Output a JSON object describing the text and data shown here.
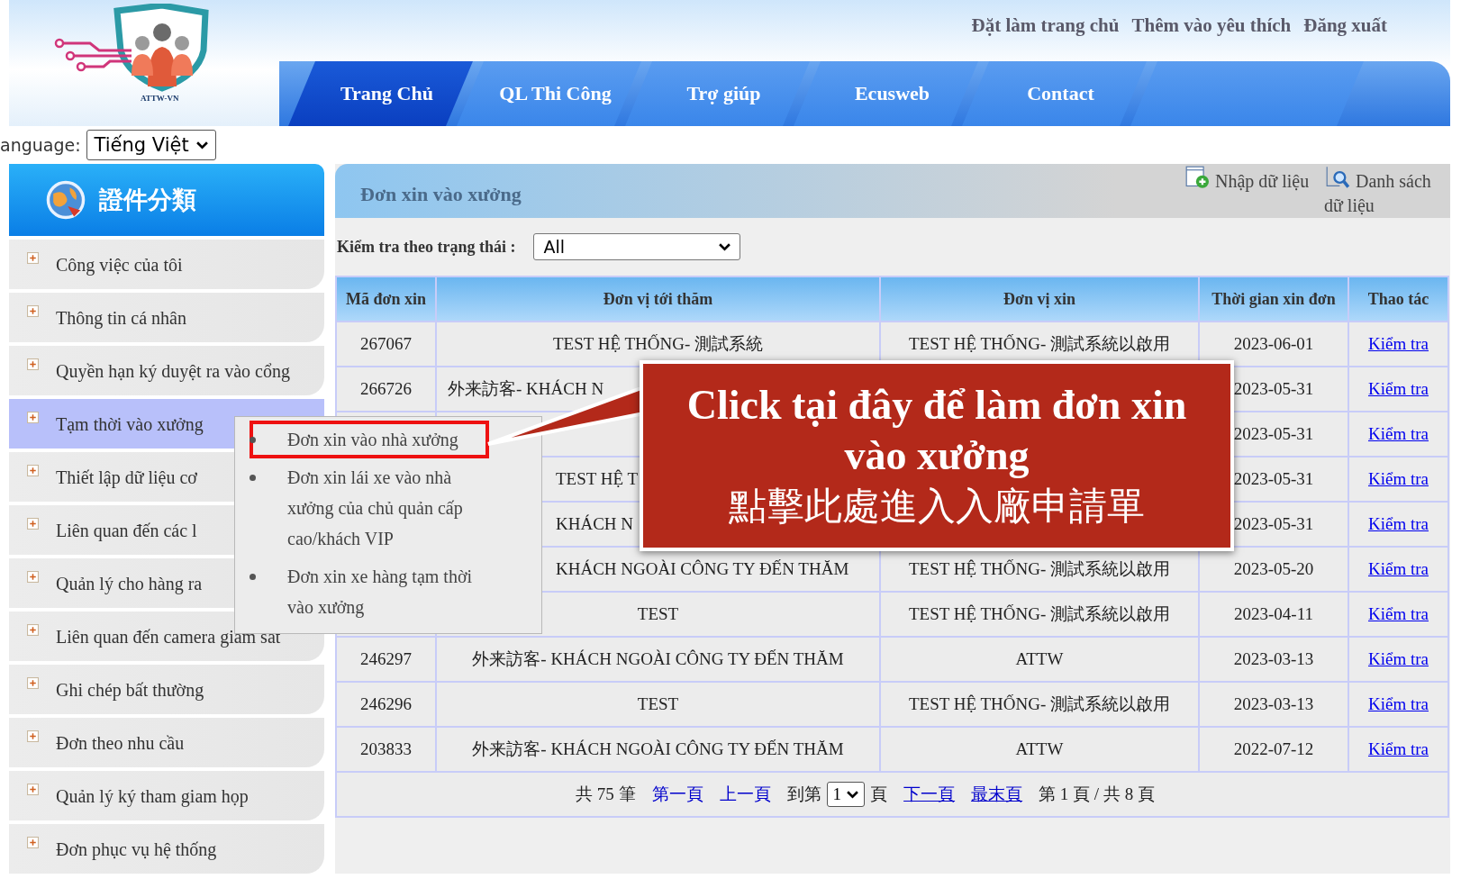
{
  "logo": {
    "caption": "ATTW-VN"
  },
  "top_links": [
    "Đặt làm trang chủ",
    "Thêm vào yêu thích",
    "Đăng xuất"
  ],
  "tabs": [
    {
      "label": "Trang Chủ",
      "selected": true
    },
    {
      "label": "QL Thi Công",
      "selected": false
    },
    {
      "label": "Trợ giúp",
      "selected": false
    },
    {
      "label": "Ecusweb",
      "selected": false
    },
    {
      "label": "Contact",
      "selected": false
    }
  ],
  "language": {
    "label": "anguage:",
    "value": "Tiếng Việt"
  },
  "sidebar": {
    "title": "證件分類",
    "items": [
      {
        "label": "Công việc của tôi",
        "selected": false
      },
      {
        "label": "Thông tin cá nhân",
        "selected": false
      },
      {
        "label": "Quyền hạn ký duyệt ra vào cổng",
        "selected": false
      },
      {
        "label": "Tạm thời vào xưởng",
        "selected": true
      },
      {
        "label": "Thiết lập dữ liệu cơ",
        "selected": false
      },
      {
        "label": "Liên quan đến các l",
        "selected": false
      },
      {
        "label": "Quản lý cho hàng ra",
        "selected": false
      },
      {
        "label": "Liên quan đến camera giám sát",
        "selected": false
      },
      {
        "label": "Ghi chép bất thường",
        "selected": false
      },
      {
        "label": "Đơn theo nhu cầu",
        "selected": false
      },
      {
        "label": "Quản lý ký tham giam họp",
        "selected": false
      },
      {
        "label": "Đơn phục vụ hệ thống",
        "selected": false
      }
    ]
  },
  "submenu": [
    {
      "label": "Đơn xin vào nhà xưởng",
      "highlighted": true
    },
    {
      "label": "Đơn xin lái xe vào nhà xưởng của chủ quản cấp cao/khách VIP",
      "highlighted": false
    },
    {
      "label": "Đơn xin xe hàng tạm thời vào xưởng",
      "highlighted": false
    }
  ],
  "panel": {
    "title": "Đơn xin vào xưởng",
    "actions": [
      "Nhập dữ liệu",
      "Danh sách dữ liệu"
    ]
  },
  "filter": {
    "label": "Kiểm tra theo trạng thái :",
    "value": "All"
  },
  "table": {
    "columns": [
      "Mã đơn xin",
      "Đơn vị tới thăm",
      "Đơn vị xin",
      "Thời gian xin đơn",
      "Thao tác"
    ],
    "rows": [
      [
        "267067",
        "TEST HỆ THỐNG- 測試系統",
        "TEST HỆ THỐNG- 測試系統以啟用",
        "2023-06-01",
        "Kiểm tra"
      ],
      [
        "266726",
        "外来訪客- KHÁCH N",
        "",
        "2023-05-31",
        "Kiểm tra"
      ],
      [
        "",
        "",
        "",
        "2023-05-31",
        "Kiểm tra"
      ],
      [
        "",
        "TEST HỆ T",
        "",
        "2023-05-31",
        "Kiểm tra"
      ],
      [
        "",
        "KHÁCH N",
        "",
        "2023-05-31",
        "Kiểm tra"
      ],
      [
        "",
        "KHÁCH NGOÀI CÔNG TY ĐẾN THĂM",
        "TEST HỆ THỐNG- 測試系統以啟用",
        "2023-05-20",
        "Kiểm tra"
      ],
      [
        "",
        "TEST",
        "TEST HỆ THỐNG- 測試系統以啟用",
        "2023-04-11",
        "Kiểm tra"
      ],
      [
        "246297",
        "外来訪客- KHÁCH NGOÀI CÔNG TY ĐẾN THĂM",
        "ATTW",
        "2023-03-13",
        "Kiểm tra"
      ],
      [
        "246296",
        "TEST",
        "TEST HỆ THỐNG- 測試系統以啟用",
        "2023-03-13",
        "Kiểm tra"
      ],
      [
        "203833",
        "外来訪客- KHÁCH NGOÀI CÔNG TY ĐẾN THĂM",
        "ATTW",
        "2022-07-12",
        "Kiểm tra"
      ]
    ]
  },
  "pager": {
    "total": "共 75 筆",
    "first": {
      "label": "第一頁",
      "disabled": true
    },
    "prev": {
      "label": "上一頁",
      "disabled": true
    },
    "goto": "到第",
    "page_value": "1",
    "page_unit": "頁",
    "next": {
      "label": "下一頁",
      "disabled": false
    },
    "last": {
      "label": "最末頁",
      "disabled": false
    },
    "status": "第 1 頁 / 共 8 頁"
  },
  "callout": {
    "lines": [
      "Click tại đây để làm đơn xin vào xưởng",
      "點擊此處進入入廠申請單"
    ]
  }
}
